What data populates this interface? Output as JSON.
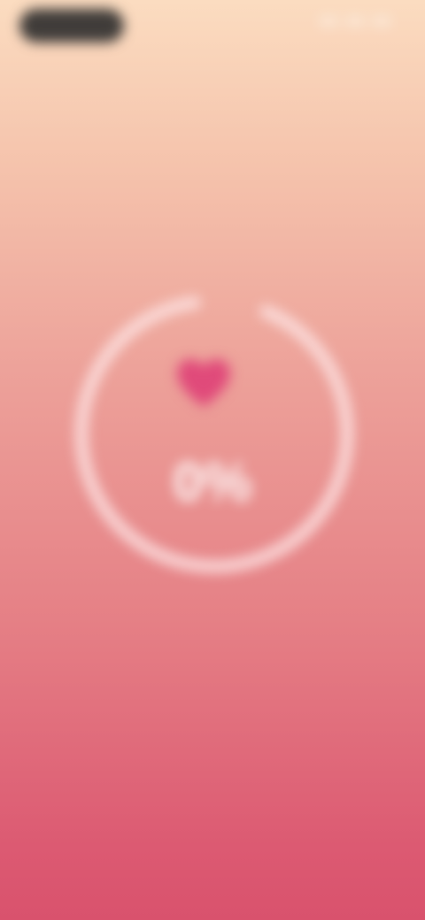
{
  "status_bar": {
    "left_pill": "",
    "icons": [
      "signal-icon",
      "wifi-icon",
      "battery-icon"
    ]
  },
  "header": {
    "back_label": "",
    "title": "",
    "subtitle": ""
  },
  "progress": {
    "value_percent": 0,
    "label": "0%",
    "icon": "heart-icon",
    "ring_color": "#fde4e4",
    "heart_color": "#e04a7a"
  },
  "colors": {
    "background_top": "#fbdcc0",
    "background_bottom": "#d9526d"
  }
}
